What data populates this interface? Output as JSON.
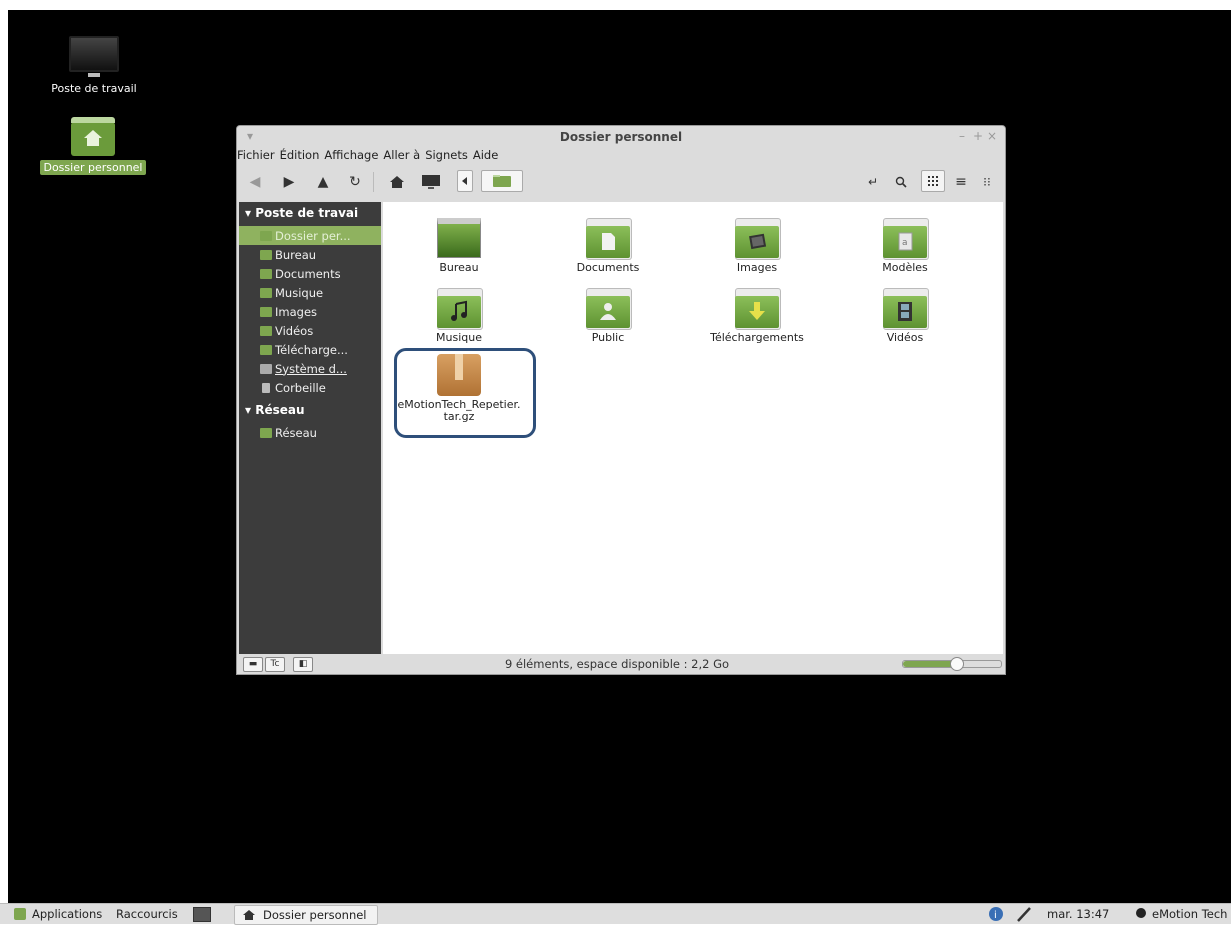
{
  "desktop": {
    "icons": [
      {
        "label": "Poste de travail"
      },
      {
        "label": "Dossier personnel"
      }
    ]
  },
  "window": {
    "title": "Dossier personnel",
    "controls": {
      "minimize": "–",
      "maximize": "+",
      "close": "×",
      "menu": "▾"
    },
    "menubar": [
      "Fichier",
      "Édition",
      "Affichage",
      "Aller à",
      "Signets",
      "Aide"
    ],
    "toolbar_icons": [
      "back-icon",
      "forward-icon",
      "up-icon",
      "reload-icon",
      "home-icon",
      "computer-icon",
      "breadcrumb-left-icon",
      "breadcrumb-home-icon",
      "toggle-location-icon",
      "search-icon",
      "icon-view-icon",
      "list-view-icon",
      "compact-view-icon"
    ]
  },
  "sidebar": {
    "section1": "Poste de travai",
    "items": [
      {
        "label": "Dossier per..."
      },
      {
        "label": "Bureau"
      },
      {
        "label": "Documents"
      },
      {
        "label": "Musique"
      },
      {
        "label": "Images"
      },
      {
        "label": "Vidéos"
      },
      {
        "label": "Télécharge..."
      },
      {
        "label": "Système d..."
      },
      {
        "label": "Corbeille"
      }
    ],
    "section2": "Réseau",
    "network_items": [
      {
        "label": "Réseau"
      }
    ]
  },
  "files": [
    {
      "label": "Bureau"
    },
    {
      "label": "Documents"
    },
    {
      "label": "Images"
    },
    {
      "label": "Modèles"
    },
    {
      "label": "Musique"
    },
    {
      "label": "Public"
    },
    {
      "label": "Téléchargements"
    },
    {
      "label": "Vidéos"
    },
    {
      "label": "eMotionTech_Repetier.\ntar.gz"
    }
  ],
  "statusbar": {
    "text": "9 éléments, espace disponible : 2,2 Go",
    "zoom_level": 0.55,
    "buttons": [
      "Tc"
    ]
  },
  "taskbar": {
    "applications": "Applications",
    "shortcuts": "Raccourcis",
    "window_button": "Dossier personnel",
    "clock": "mar. 13:47",
    "user": "eMotion Tech",
    "colors": {
      "accent": "#7ea64f",
      "highlight_border": "#2e4f7a",
      "sidebar_bg": "#3c3c3c"
    }
  }
}
